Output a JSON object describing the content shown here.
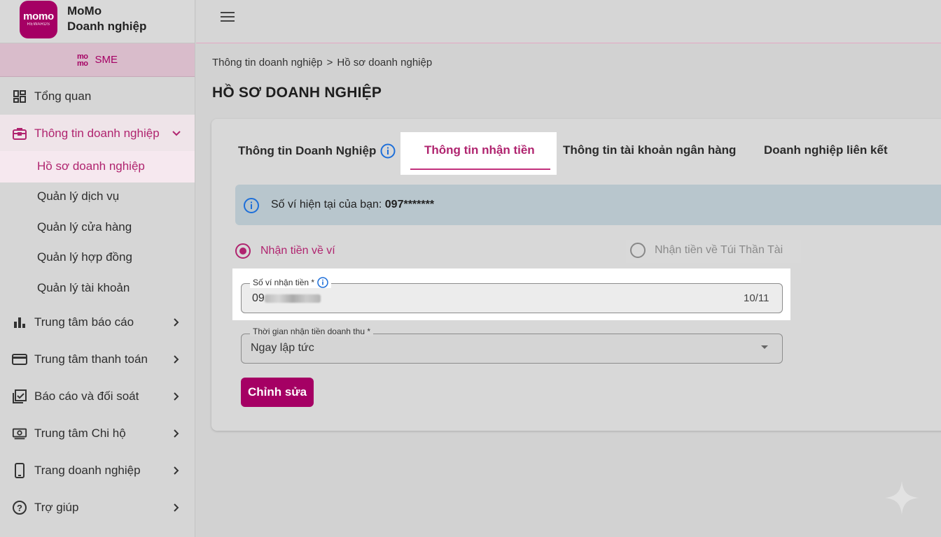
{
  "brand": {
    "logo_line1": "momo",
    "logo_line2": "REWARDS",
    "title_line1": "MoMo",
    "title_line2": "Doanh nghiệp",
    "sme_mark_top": "mo",
    "sme_mark_bottom": "mo",
    "sme_label": "SME"
  },
  "sidebar": {
    "items": [
      {
        "label": "Tổng quan",
        "icon": "dashboard-icon"
      },
      {
        "label": "Thông tin doanh nghiệp",
        "icon": "briefcase-icon"
      },
      {
        "label": "Trung tâm báo cáo",
        "icon": "bar-chart-icon"
      },
      {
        "label": "Trung tâm thanh toán",
        "icon": "credit-card-icon"
      },
      {
        "label": "Báo cáo và đối soát",
        "icon": "checklist-icon"
      },
      {
        "label": "Trung tâm Chi hộ",
        "icon": "payout-icon"
      },
      {
        "label": "Trang doanh nghiệp",
        "icon": "phone-icon"
      },
      {
        "label": "Trợ giúp",
        "icon": "help-icon"
      }
    ],
    "sub_items": [
      "Hồ sơ doanh nghiệp",
      "Quản lý dịch vụ",
      "Quản lý cửa hàng",
      "Quản lý hợp đồng",
      "Quản lý tài khoản"
    ]
  },
  "breadcrumb": {
    "parent": "Thông tin doanh nghiệp",
    "separator": ">",
    "current": "Hồ sơ doanh nghiệp"
  },
  "page": {
    "title": "HỒ SƠ DOANH NGHIỆP"
  },
  "tabs": [
    {
      "label": "Thông tin Doanh Nghiệp",
      "active": false
    },
    {
      "label": "Thông tin nhận tiền",
      "active": true
    },
    {
      "label": "Thông tin tài khoản ngân hàng",
      "active": false
    },
    {
      "label": "Doanh nghiệp liên kết",
      "active": false
    }
  ],
  "info_banner": {
    "text": "Số ví hiện tại của bạn: ",
    "value": "097*******"
  },
  "receive_options": {
    "wallet": "Nhận tiền về ví",
    "tui_than_tai": "Nhận tiền về Túi Thần Tài",
    "selected": "wallet"
  },
  "wallet_field": {
    "label": "Số ví nhận tiền *",
    "value_prefix": "09",
    "counter": "10/11"
  },
  "revenue_time_field": {
    "label": "Thời gian nhận tiền doanh thu *",
    "value": "Ngay lập tức"
  },
  "actions": {
    "edit_label": "Chỉnh sửa"
  },
  "colors": {
    "brand": "#a50064",
    "accent": "#b0246f",
    "info_banner_bg": "#b8c6cd",
    "info_icon": "#1e6fd9"
  }
}
